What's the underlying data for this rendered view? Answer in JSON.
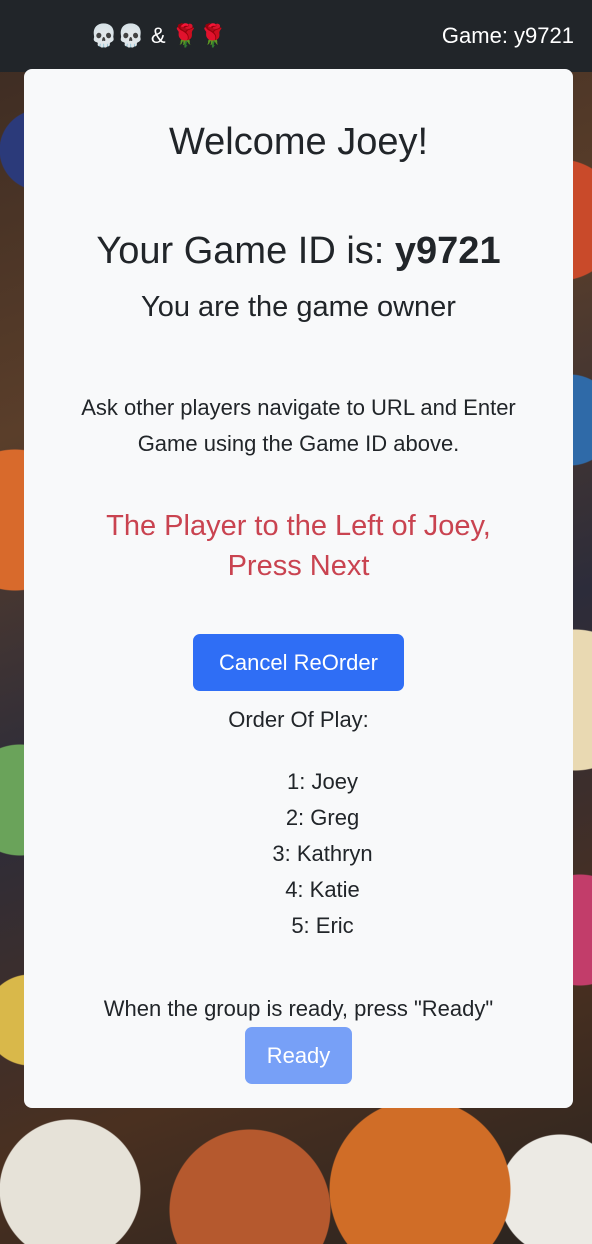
{
  "navbar": {
    "brand": "💀💀 & 🌹🌹",
    "game_label": "Game: y9721"
  },
  "card": {
    "welcome": "Welcome Joey!",
    "game_id_prefix": "Your Game ID is: ",
    "game_id": "y9721",
    "owner_text": "You are the game owner",
    "instructions": "Ask other players navigate to URL and Enter Game using the Game ID above.",
    "alert_line1": "The Player to the Left of Joey,",
    "alert_line2": "Press Next",
    "cancel_button": "Cancel ReOrder",
    "order_label": "Order Of Play:",
    "players": [
      "1: Joey",
      "2: Greg",
      "3: Kathryn",
      "4: Katie",
      "5: Eric"
    ],
    "ready_text": "When the group is ready, press \"Ready\"",
    "ready_button": "Ready"
  },
  "colors": {
    "navbar": "#212529",
    "card": "#f8f9fa",
    "alert": "#c94350",
    "primary_button": "#2f6ef5",
    "disabled_button": "#77a0f7"
  }
}
